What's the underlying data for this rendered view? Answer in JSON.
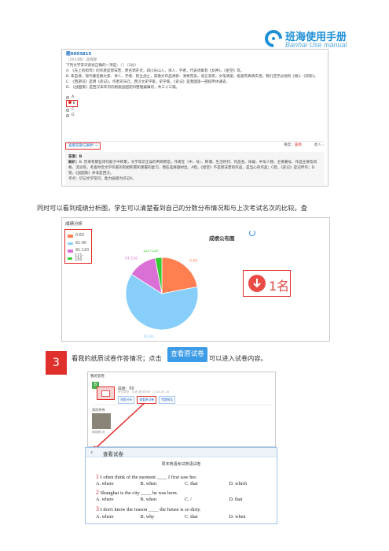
{
  "brand": {
    "title": "班海使用手册",
    "subtitle": "Banhai Use manual"
  },
  "question_screenshot": {
    "id": "题9093815",
    "meta": "（2014高）选择题",
    "stem": "下列文学常识表述正确的一项是：（    ）（3分）",
    "statements": [
      "A. 《天上的街市》的作者是郭沫若，原名郭开贞，四川乐山人，诗人、学者，代表诗集有《女神》、《星空》等。",
      "B. 朱自清，现代著名散文家、诗人、学者、民主战士，其散文作品清新、清秀完美，语言洗练，文笔清丽，极富有真情实感，我们还学过他的《春》、《背影》。",
      "C. 《西游记》是明《史记》，作者司马迁，西汉文史学家，史学家，《史记》是我国第一部纪传体通史。",
      "D. 《战国策》是西汉末年刘向根据战国史料整理编辑的，共三十三篇。"
    ],
    "options": [
      "A",
      "B",
      "C",
      "D"
    ],
    "selected": "B",
    "view_analysis": "查看答题与解析 →",
    "difficulty_label": "难度：",
    "difficulty_value": "容易",
    "collect": "收入 ›",
    "answer_label": "答案：B",
    "analysis_label": "解析：",
    "analysis_text": "B. 历来有那些诗句能于中积累，文学常识正误的判断原是，作者在（中、号）、称谓、生活时代、作品名、体裁、中华人物、主要著号、作品主要及风格、流派等，考查时近文学作家的有相积累和掌握的复习，而在选择题材出，A错，《星空》不是郭沫若的作品，是当心的作品；C错，《史记》是记传作；D错，《战国策》并非是西汉。",
    "knowledge": "考点：识记文学常识。能力层级为识记A。"
  },
  "line_text": "同时可以看到成绩分析图，学生可以清楚看到自己的分数分布情况和与上次考试名次的比较。查",
  "chart_panel": {
    "title": "成绩分析",
    "chart_title": "成绩公布图",
    "rank_change": "1名"
  },
  "chart_data": {
    "type": "pie",
    "title": "成绩公布图",
    "categories": [
      "0-60",
      "61-90",
      "91-120",
      "121-150"
    ],
    "values": [
      22,
      62,
      13,
      3
    ],
    "colors": [
      "#ff7f50",
      "#87cefa",
      "#da70d6",
      "#32cd32"
    ]
  },
  "step3": {
    "number": "3",
    "text_before": "看我的纸质试卷作答情况；点击",
    "button": "查看原试卷",
    "text_after": "可以进入试卷内容。"
  },
  "paper_card": {
    "title": "我的答卷",
    "tag": "B",
    "score": "成绩：00",
    "meta": "考试类型：月考  考试时间：2016-09-28",
    "buttons": [
      "答题分析",
      "查看原试卷",
      "错题报告"
    ],
    "original_label": "我的原卷",
    "original_thumb_label": "原卷第1页"
  },
  "view_paper": {
    "title": "查看试卷",
    "paper_name": "周末英语考试英语试卷",
    "questions": [
      {
        "num": "1",
        "text": "I often think of the moment ____ I first saw her.",
        "options": [
          "A. where",
          "B. when",
          "C. that",
          "D. which"
        ]
      },
      {
        "num": "2",
        "text": "Shanghai is the city ____ he was born.",
        "options": [
          "A. where",
          "B. when",
          "C. /",
          "D. that"
        ]
      },
      {
        "num": "3",
        "text": "I don't know the reason ____ the house is so dirty.",
        "options": [
          "A. where",
          "B. why",
          "C. that",
          "D. when"
        ]
      }
    ]
  }
}
